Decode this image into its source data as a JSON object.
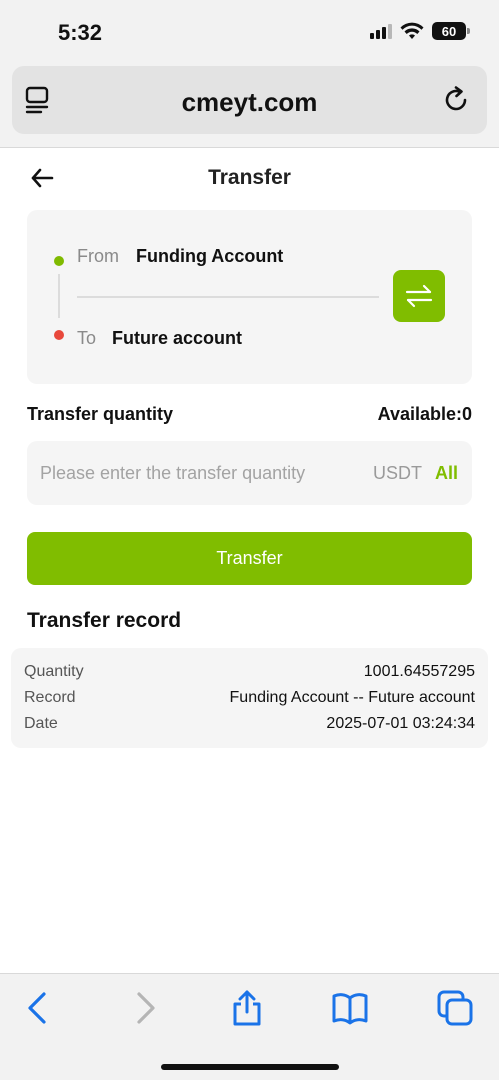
{
  "status_bar": {
    "time": "5:32",
    "battery": "60",
    "icons": [
      "signal-icon",
      "wifi-icon",
      "battery-icon"
    ]
  },
  "browser": {
    "url": "cmeyt.com",
    "icons": [
      "reader-icon",
      "reload-icon"
    ]
  },
  "header": {
    "title": "Transfer",
    "back_icon": "arrow-left-icon"
  },
  "accounts": {
    "from_label": "From",
    "from_value": "Funding Account",
    "to_label": "To",
    "to_value": "Future account",
    "swap_icon": "swap-icon"
  },
  "quantity": {
    "label": "Transfer quantity",
    "available": "Available:0",
    "placeholder": "Please enter the transfer quantity",
    "value": "",
    "unit": "USDT",
    "all_label": "All"
  },
  "transfer_button_label": "Transfer",
  "record": {
    "title": "Transfer record",
    "rows": [
      {
        "key": "Quantity",
        "value": "1001.64557295"
      },
      {
        "key": "Record",
        "value": "Funding Account -- Future account"
      },
      {
        "key": "Date",
        "value": "2025-07-01 03:24:34"
      }
    ]
  },
  "toolbar": {
    "icons": [
      "back-icon",
      "forward-icon",
      "share-icon",
      "bookmarks-icon",
      "tabs-icon"
    ]
  },
  "colors": {
    "accent": "#80bd00",
    "from_dot": "#7fba00",
    "to_dot": "#e8483b",
    "safari_blue": "#1a73e8"
  }
}
